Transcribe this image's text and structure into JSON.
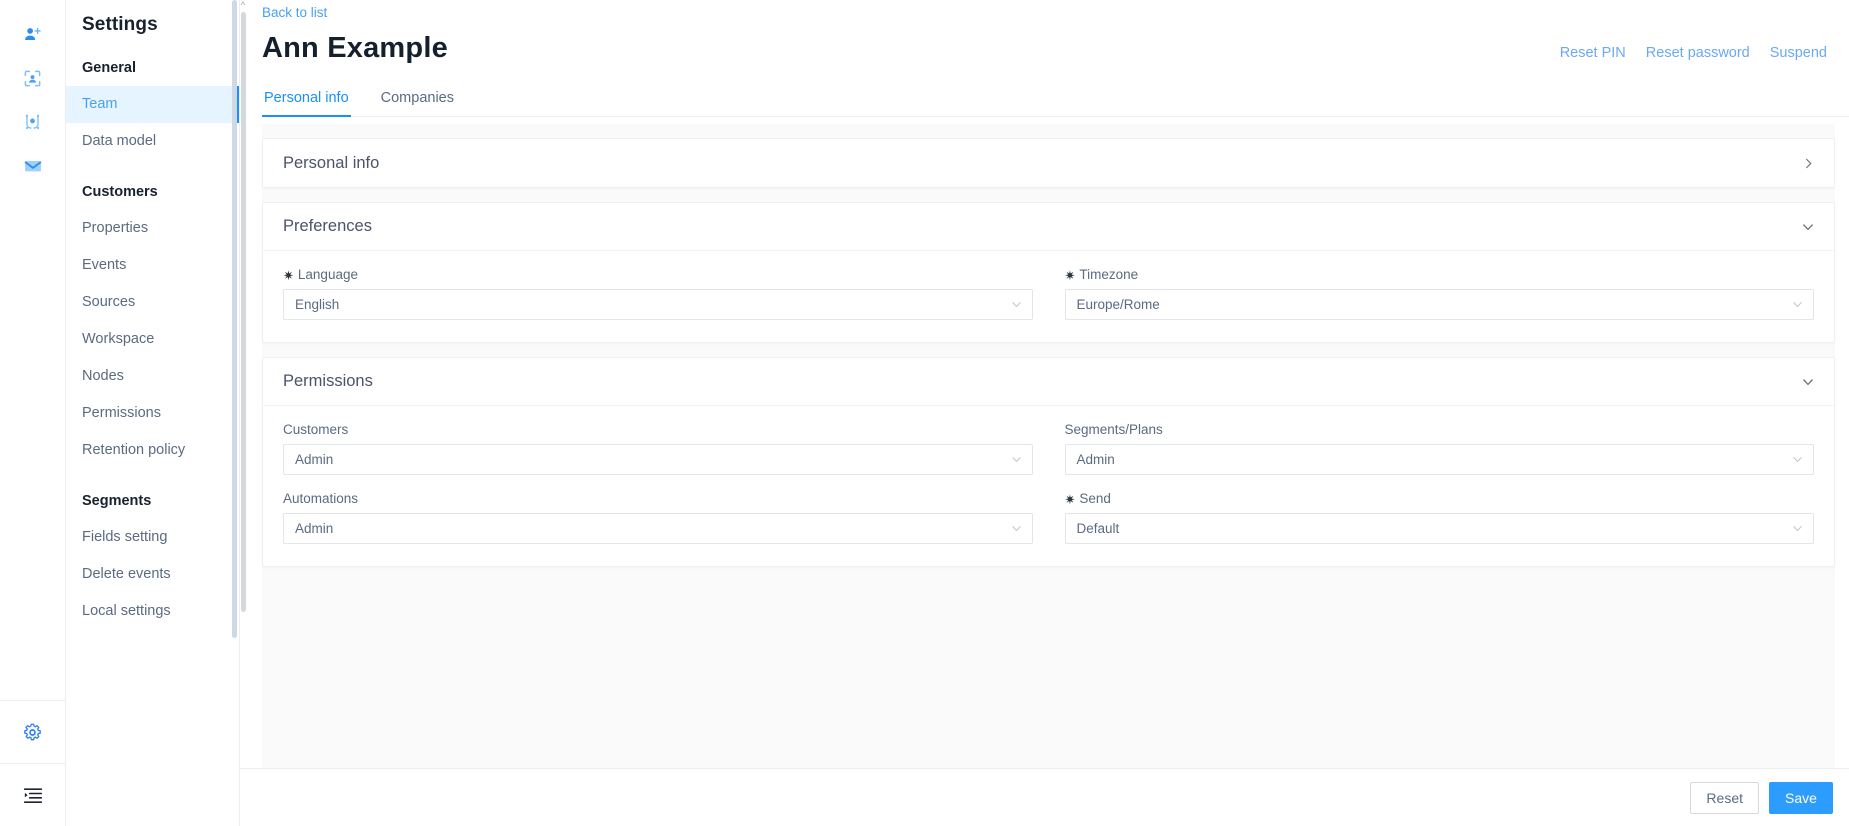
{
  "rail": {
    "items": [
      {
        "name": "add-user-icon",
        "label": "Add user"
      },
      {
        "name": "identify-user-icon",
        "label": "Identify user"
      },
      {
        "name": "node-flow-icon",
        "label": "Nodes"
      },
      {
        "name": "mail-icon",
        "label": "Messages"
      }
    ],
    "bottom": [
      {
        "name": "gear-icon",
        "label": "Settings"
      },
      {
        "name": "collapse-list-icon",
        "label": "Collapse menu"
      }
    ],
    "accent": "#2d9cff"
  },
  "sidebar": {
    "title": "Settings",
    "sections": [
      {
        "group": "General",
        "items": [
          {
            "label": "Team",
            "active": true
          },
          {
            "label": "Data model",
            "active": false
          }
        ]
      },
      {
        "group": "Customers",
        "items": [
          {
            "label": "Properties",
            "active": false
          },
          {
            "label": "Events",
            "active": false
          },
          {
            "label": "Sources",
            "active": false
          },
          {
            "label": "Workspace",
            "active": false
          },
          {
            "label": "Nodes",
            "active": false
          },
          {
            "label": "Permissions",
            "active": false
          },
          {
            "label": "Retention policy",
            "active": false
          }
        ]
      },
      {
        "group": "Segments",
        "items": [
          {
            "label": "Fields setting",
            "active": false
          },
          {
            "label": "Delete events",
            "active": false
          },
          {
            "label": "Local settings",
            "active": false
          }
        ]
      }
    ]
  },
  "header": {
    "back_label": "Back to list",
    "title": "Ann Example",
    "actions": [
      {
        "label": "Reset PIN"
      },
      {
        "label": "Reset password"
      },
      {
        "label": "Suspend"
      }
    ]
  },
  "tabs": [
    {
      "label": "Personal info",
      "active": true
    },
    {
      "label": "Companies",
      "active": false
    }
  ],
  "panels": {
    "personal_info": {
      "title": "Personal info",
      "collapsed": true,
      "chevron": "chevron-right-icon"
    },
    "preferences": {
      "title": "Preferences",
      "collapsed": false,
      "chevron": "chevron-down-icon",
      "fields": [
        {
          "label": "Language",
          "required": true,
          "value": "English"
        },
        {
          "label": "Timezone",
          "required": true,
          "value": "Europe/Rome"
        }
      ]
    },
    "permissions": {
      "title": "Permissions",
      "collapsed": false,
      "chevron": "chevron-down-icon",
      "fields": [
        {
          "label": "Customers",
          "required": false,
          "value": "Admin"
        },
        {
          "label": "Segments/Plans",
          "required": false,
          "value": "Admin"
        },
        {
          "label": "Automations",
          "required": false,
          "value": "Admin"
        },
        {
          "label": "Send",
          "required": true,
          "value": "Default"
        }
      ]
    }
  },
  "footer": {
    "reset_label": "Reset",
    "save_label": "Save"
  },
  "required_marker": "✷",
  "colors": {
    "accent": "#1890ff",
    "link": "#6aa9f7",
    "active_nav_bg": "#e6f4ff",
    "primary_button": "#2d9cff",
    "page_bg": "#fafafa"
  }
}
